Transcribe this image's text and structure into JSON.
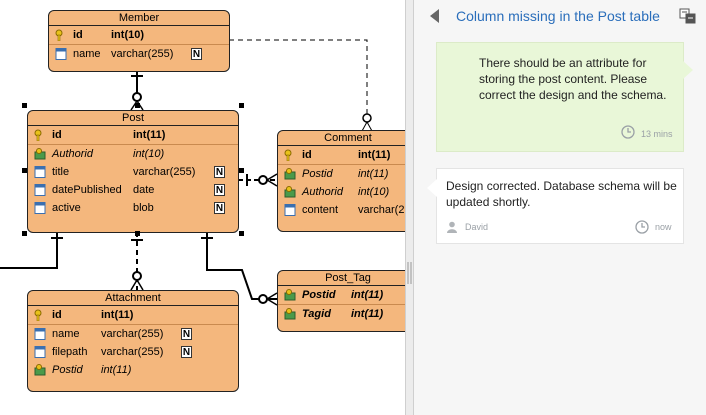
{
  "diagram": {
    "member": {
      "title": "Member",
      "cols": [
        {
          "name": "id",
          "type": "int(10)"
        },
        {
          "name": "name",
          "type": "varchar(255)",
          "nullable": "N"
        }
      ]
    },
    "post": {
      "title": "Post",
      "cols": [
        {
          "name": "id",
          "type": "int(11)"
        },
        {
          "name": "Authorid",
          "type": "int(10)"
        },
        {
          "name": "title",
          "type": "varchar(255)",
          "nullable": "N"
        },
        {
          "name": "datePublished",
          "type": "date",
          "nullable": "N"
        },
        {
          "name": "active",
          "type": "blob",
          "nullable": "N"
        }
      ]
    },
    "comment": {
      "title": "Comment",
      "cols": [
        {
          "name": "id",
          "type": "int(11)"
        },
        {
          "name": "Postid",
          "type": "int(11)"
        },
        {
          "name": "Authorid",
          "type": "int(10)"
        },
        {
          "name": "content",
          "type": "varchar(2"
        }
      ]
    },
    "attachment": {
      "title": "Attachment",
      "cols": [
        {
          "name": "id",
          "type": "int(11)"
        },
        {
          "name": "name",
          "type": "varchar(255)",
          "nullable": "N"
        },
        {
          "name": "filepath",
          "type": "varchar(255)",
          "nullable": "N"
        },
        {
          "name": "Postid",
          "type": "int(11)"
        }
      ]
    },
    "post_tag": {
      "title": "Post_Tag",
      "cols": [
        {
          "name": "Postid",
          "type": "int(11)"
        },
        {
          "name": "Tagid",
          "type": "int(11)"
        }
      ]
    }
  },
  "panel": {
    "title": "Column missing in the Post table",
    "messages": [
      {
        "text": "There should be an attribute for storing the post content. Please correct the design and the schema.",
        "time": "13 mins"
      },
      {
        "text": "Design corrected. Database schema will be updated shortly.",
        "author": "David",
        "time": "now"
      }
    ]
  },
  "colors": {
    "entity_fill": "#f4b77d",
    "link": "#2a6ebb",
    "own_bubble": "#e9f7d8"
  }
}
